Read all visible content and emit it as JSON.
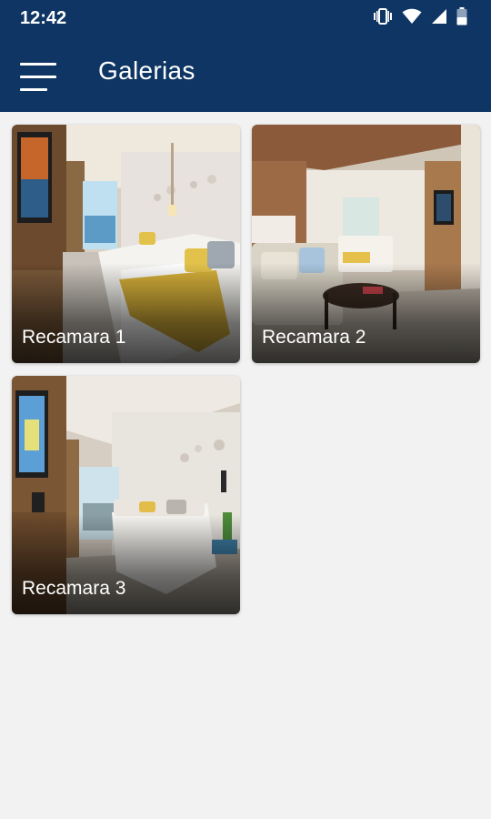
{
  "status_bar": {
    "time": "12:42",
    "icons": [
      "vibrate-icon",
      "wifi-icon",
      "signal-icon",
      "battery-icon"
    ]
  },
  "header": {
    "title": "Galerias",
    "menu_icon": "hamburger-menu-icon",
    "background": "#0e3563"
  },
  "gallery": {
    "items": [
      {
        "label": "Recamara 1"
      },
      {
        "label": "Recamara 2"
      },
      {
        "label": "Recamara 3"
      }
    ]
  }
}
